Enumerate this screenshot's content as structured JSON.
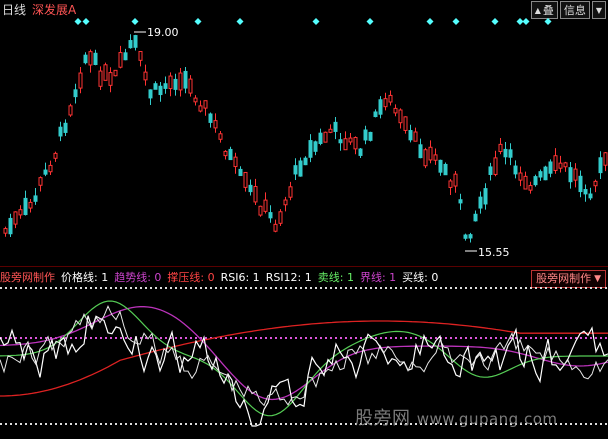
{
  "header": {
    "period": "日线",
    "stock_name": "深发展A",
    "badge_period_label": "叠",
    "badge_info_label": "信息",
    "badge_scroll_up": "▲",
    "badge_scroll_down": "▼"
  },
  "price_panel": {
    "high_label": "19.00",
    "low_label": "15.55",
    "colors": {
      "up": "#ff3333",
      "down": "#33cccc",
      "marker": "#55ffff",
      "text": "#ffffff"
    }
  },
  "indicator_bar": {
    "items": [
      {
        "label": "股旁网制作",
        "color": "#ff5555"
      },
      {
        "label": "价格线: 1",
        "color": "#ffffff"
      },
      {
        "label": "趋势线: 0",
        "color": "#cc44cc"
      },
      {
        "label": "撑压线: 0",
        "color": "#ff4444"
      },
      {
        "label": "RSI6: 1",
        "color": "#ffffff"
      },
      {
        "label": "RSI12: 1",
        "color": "#ffffff"
      },
      {
        "label": "卖线: 1",
        "color": "#66ee66"
      },
      {
        "label": "界线: 1",
        "color": "#cc44cc"
      },
      {
        "label": "买线: 0",
        "color": "#ffffff"
      }
    ],
    "tag_label": "股旁网制作",
    "tag_arrow": "▼"
  },
  "watermark": {
    "cn": "股旁网",
    "url": "www.gupang.com"
  }
}
